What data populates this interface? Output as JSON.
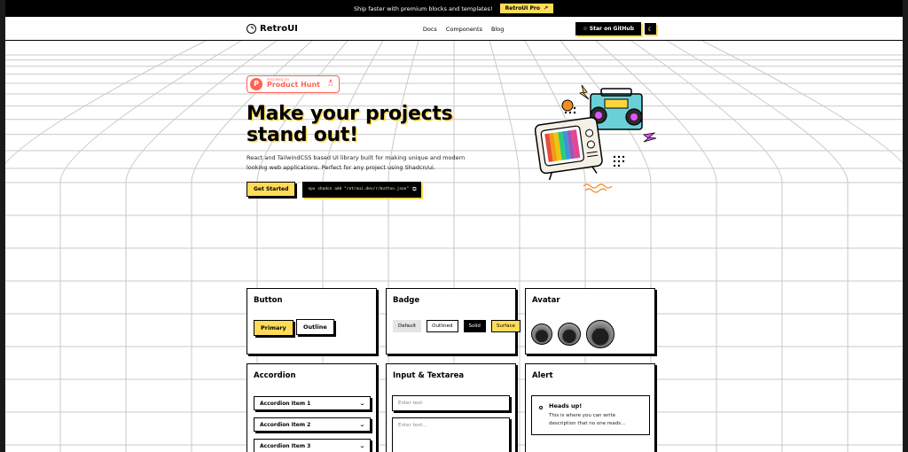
{
  "banner": {
    "text": "Ship faster with premium blocks and templates!",
    "cta_label": "RetroUI Pro",
    "cta_arrow": "↗"
  },
  "nav": {
    "brand": "RetroUI",
    "links": [
      "Docs",
      "Components",
      "Blog"
    ],
    "github_label": "Star on GitHub",
    "github_icon": "☆",
    "theme_icon": "☾"
  },
  "hero": {
    "badge": {
      "small": "FEATURED ON",
      "big": "Product Hunt",
      "rank_arrow": "▲",
      "rank_num": "21"
    },
    "title_line1": "Make your projects",
    "title_line2": "stand out!",
    "description": "React and TailwindCSS based UI library built for making unique and modern looking web applications. Perfect for any project using Shadcn/ui.",
    "cta_label": "Get Started",
    "command": "npx shadcn add \"retroui.dev/r/button.json\"",
    "command_copy_icon": "⧉"
  },
  "cards": {
    "button": {
      "title": "Button",
      "primary_label": "Primary",
      "outline_label": "Outline"
    },
    "badge": {
      "title": "Badge",
      "items": [
        "Default",
        "Outlined",
        "Solid",
        "Surface"
      ]
    },
    "avatar": {
      "title": "Avatar"
    },
    "accordion": {
      "title": "Accordion",
      "items": [
        "Accordion Item 1",
        "Accordion Item 2",
        "Accordion Item 3"
      ],
      "chevron": "⌄"
    },
    "input": {
      "title": "Input & Textarea",
      "input_placeholder": "Enter text",
      "textarea_placeholder": "Enter text..."
    },
    "alert": {
      "title": "Alert",
      "heading": "Heads up!",
      "body": "This is where you can write description that no one reads..."
    }
  },
  "colors": {
    "accent": "#ffdc58",
    "dark": "#000000",
    "producthunt": "#ff6154"
  }
}
